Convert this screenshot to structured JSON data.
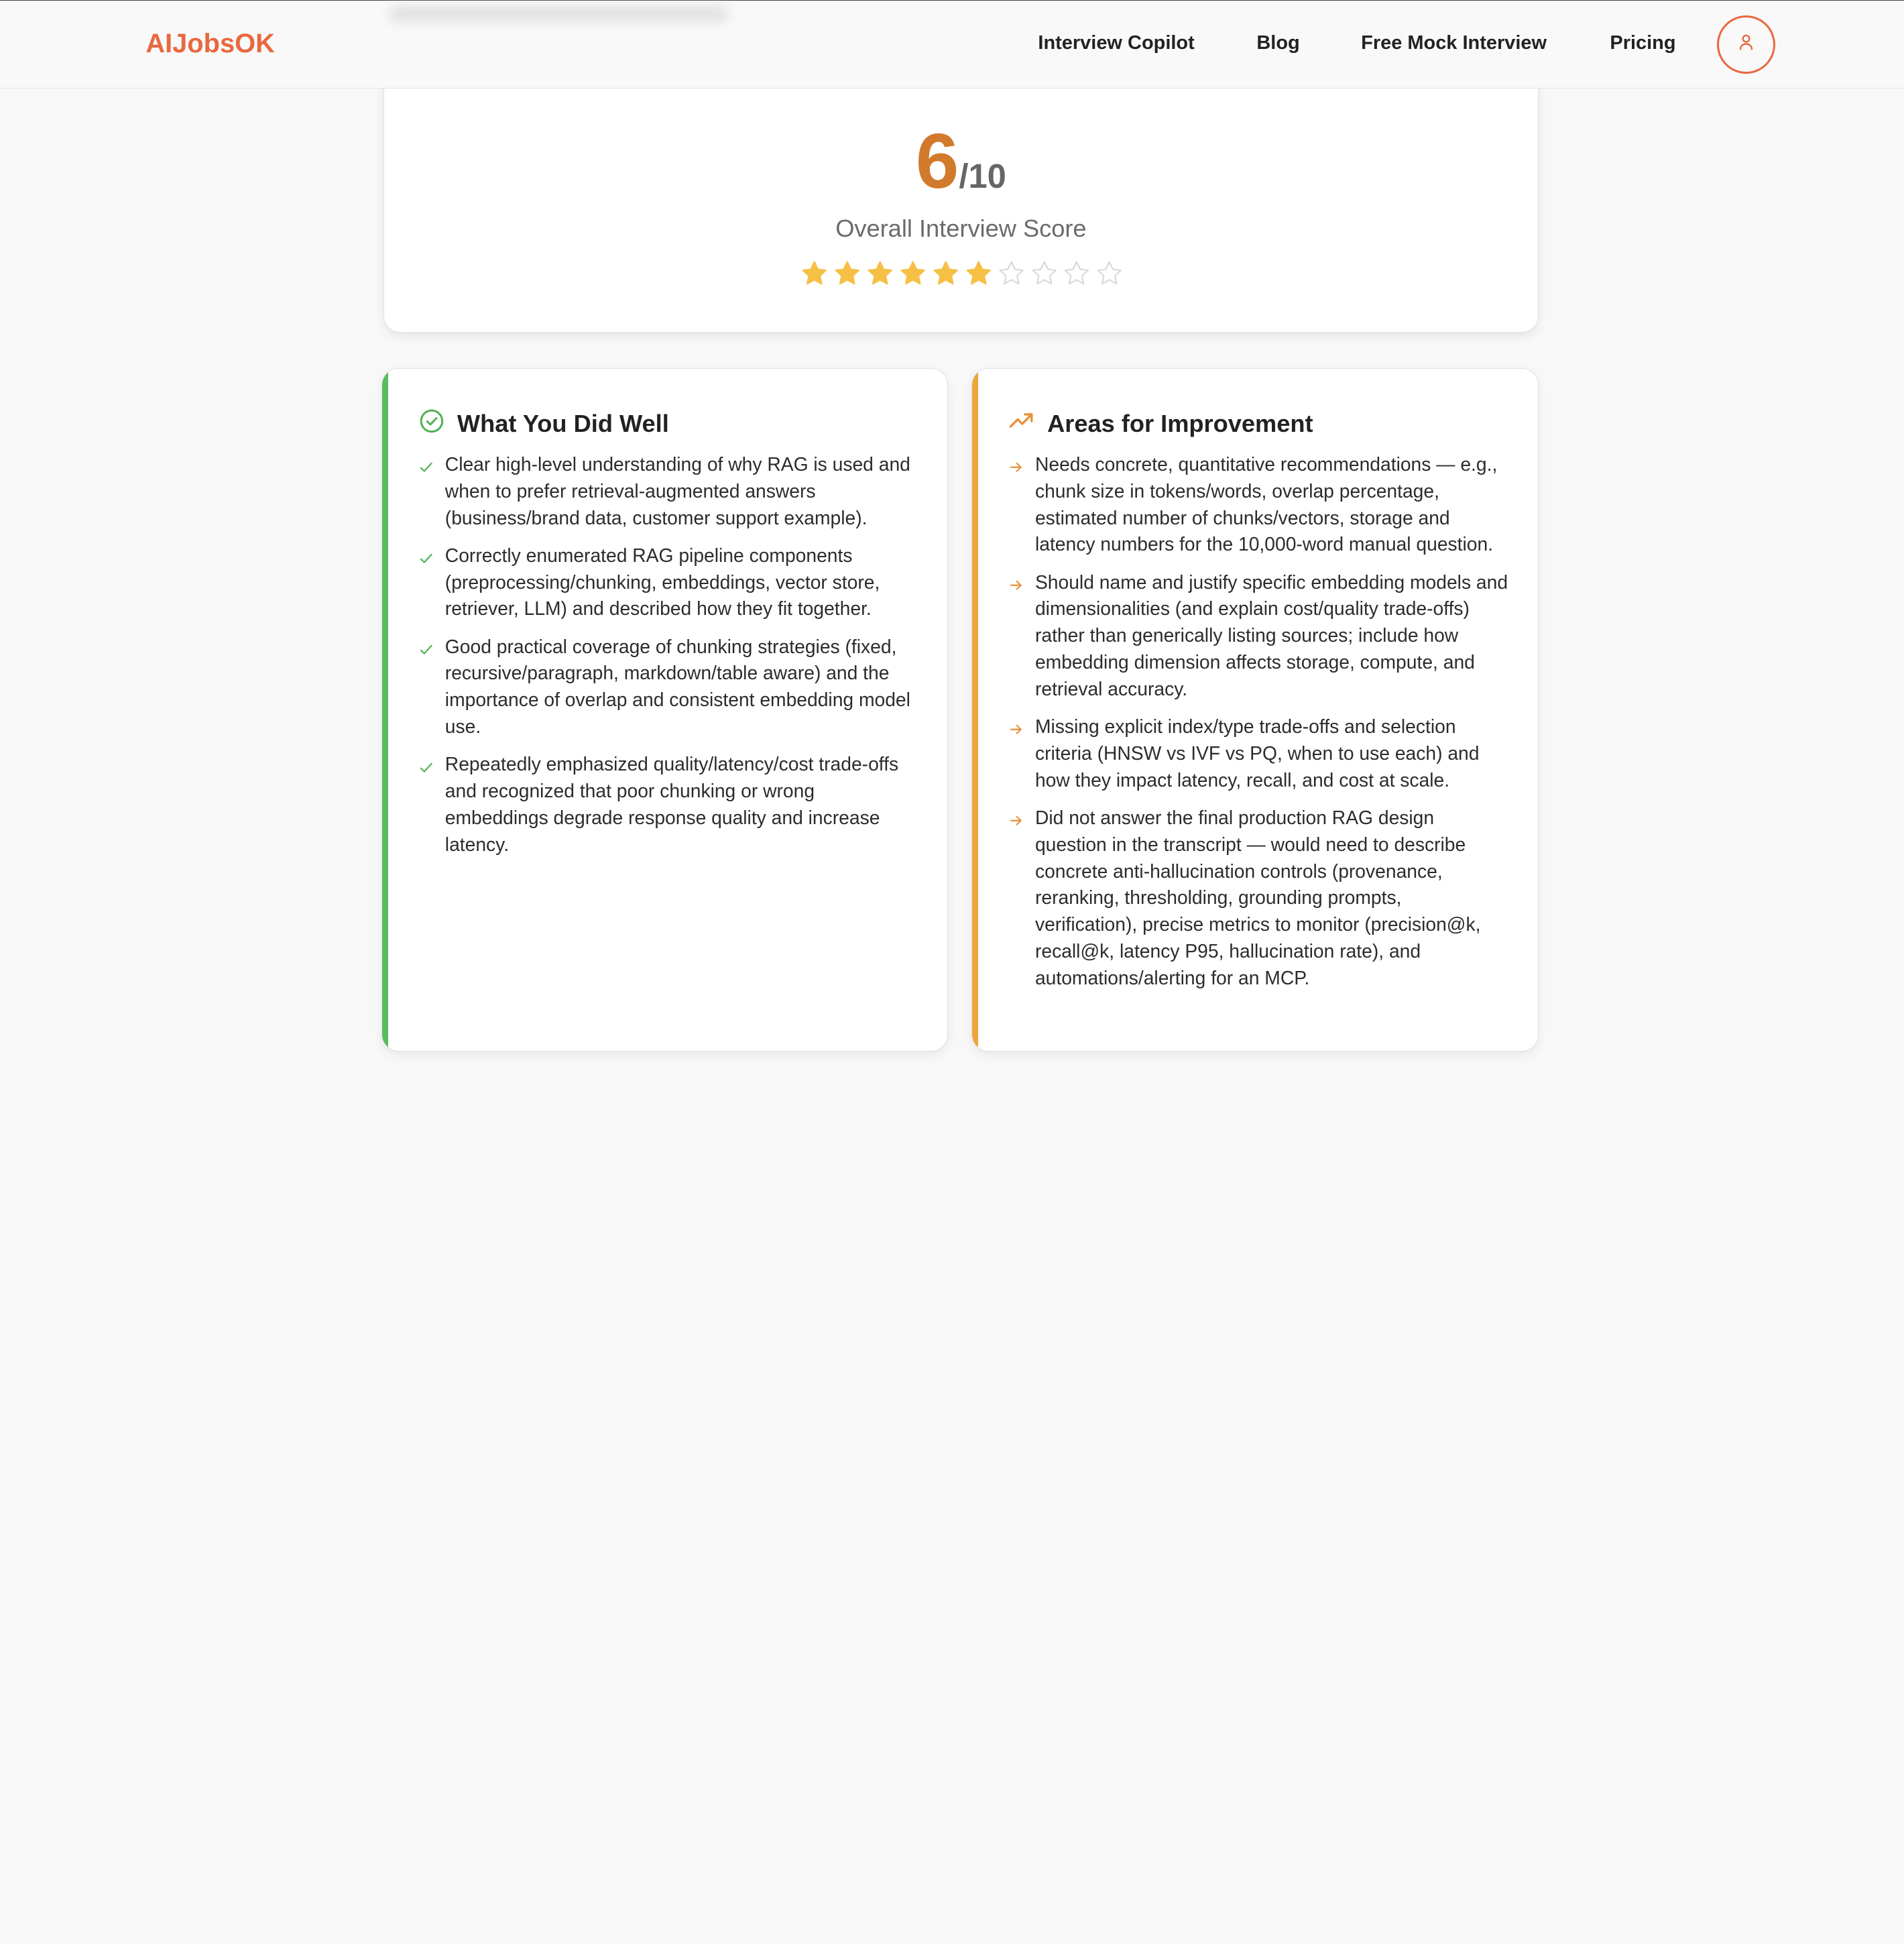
{
  "brand": "AIJobsOK",
  "nav": {
    "items": [
      {
        "label": "Interview Copilot"
      },
      {
        "label": "Blog"
      },
      {
        "label": "Free Mock Interview"
      },
      {
        "label": "Pricing"
      }
    ],
    "account_icon": "user-icon"
  },
  "score": {
    "value": "6",
    "out_of": "/10",
    "label": "Overall Interview Score",
    "stars_filled": 6,
    "stars_total": 10,
    "star_color": "#f5c044"
  },
  "strengths": {
    "title": "What You Did Well",
    "icon": "check-circle-icon",
    "accent": "#5bbb5f",
    "items": [
      "Clear high-level understanding of why RAG is used and when to prefer retrieval-augmented answers (business/brand data, customer support example).",
      "Correctly enumerated RAG pipeline components (preprocessing/chunking, embeddings, vector store, retriever, LLM) and described how they fit together.",
      "Good practical coverage of chunking strategies (fixed, recursive/paragraph, markdown/table aware) and the importance of overlap and consistent embedding model use.",
      "Repeatedly emphasized quality/latency/cost trade-offs and recognized that poor chunking or wrong embeddings degrade response quality and increase latency."
    ]
  },
  "improvements": {
    "title": "Areas for Improvement",
    "icon": "trending-up-icon",
    "accent": "#efa53e",
    "items": [
      "Needs concrete, quantitative recommendations — e.g., chunk size in tokens/words, overlap percentage, estimated number of chunks/vectors, storage and latency numbers for the 10,000-word manual question.",
      "Should name and justify specific embedding models and dimensionalities (and explain cost/quality trade-offs) rather than generically listing sources; include how embedding dimension affects storage, compute, and retrieval accuracy.",
      "Missing explicit index/type trade-offs and selection criteria (HNSW vs IVF vs PQ, when to use each) and how they impact latency, recall, and cost at scale.",
      "Did not answer the final production RAG design question in the transcript — would need to describe concrete anti-hallucination controls (provenance, reranking, thresholding, grounding prompts, verification), precise metrics to monitor (precision@k, recall@k, latency P95, hallucination rate), and automations/alerting for an MCP."
    ]
  }
}
